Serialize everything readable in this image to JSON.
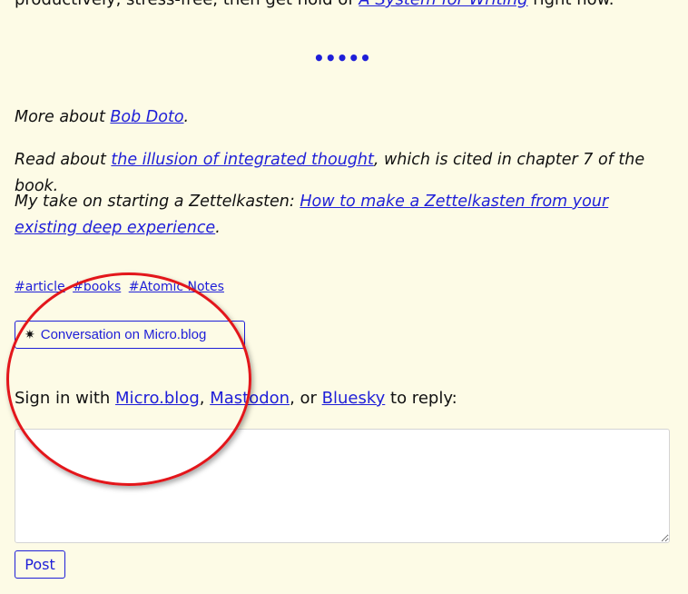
{
  "intro": {
    "prefix": "productively, stress-free, then get hold of ",
    "link": "A System for Writing",
    "suffix": " right now."
  },
  "separator": "•••••",
  "more": {
    "prefix": "More about ",
    "link": "Bob Doto",
    "suffix": "."
  },
  "read": {
    "prefix": "Read about ",
    "link": "the illusion of integrated thought",
    "suffix": ", which is cited in chapter 7 of the book."
  },
  "take": {
    "prefix": "My take on starting a Zettelkasten: ",
    "link": "How to make a Zettelkasten from your existing deep experience",
    "suffix": "."
  },
  "tags": [
    "#article",
    "#books",
    "#Atomic Notes"
  ],
  "conversation": {
    "icon": "sparkle-icon",
    "label": "Conversation on Micro.blog"
  },
  "signin": {
    "prefix": "Sign in with ",
    "micro": "Micro.blog",
    "sep1": ", ",
    "mastodon": "Mastodon",
    "sep2": ", or ",
    "bluesky": "Bluesky",
    "suffix": " to reply:"
  },
  "reply": {
    "value": ""
  },
  "post_label": "Post",
  "colors": {
    "background": "#fdfbe6",
    "link": "#1e1ed8",
    "annotation": "#e3161b"
  }
}
